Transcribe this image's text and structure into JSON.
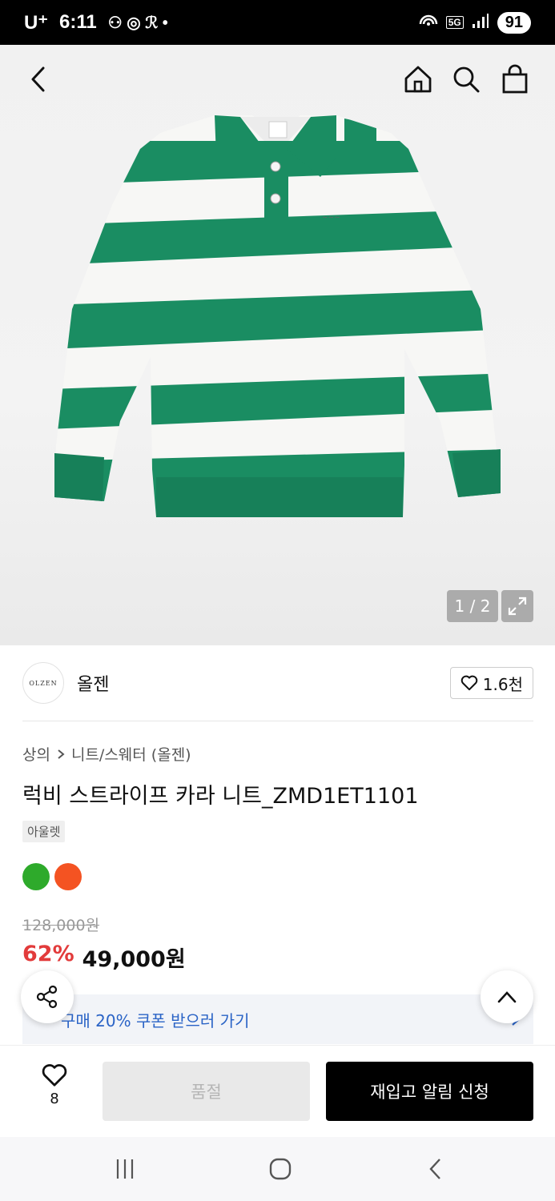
{
  "status_bar": {
    "carrier": "U⁺",
    "time": "6:11",
    "network": "5G",
    "battery": "91"
  },
  "colors": {
    "accent_red": "#e23b3b",
    "link_blue": "#2a63c6",
    "sweater_green": "#1a8d62",
    "swatch_green": "#2eaa2b",
    "swatch_orange": "#f45322"
  },
  "gallery": {
    "counter": "1 / 2"
  },
  "brand": {
    "logo_text": "OLZEN",
    "name": "올젠",
    "likes": "1.6천"
  },
  "breadcrumb": {
    "category": "상의",
    "subcategory": "니트/스웨터 (올젠)"
  },
  "product": {
    "title": "럭비 스트라이프 카라 니트_ZMD1ET1101",
    "tag": "아울렛",
    "swatches": [
      "green",
      "orange"
    ],
    "original_price": "128,000원",
    "discount": "62%",
    "price": "49,000원"
  },
  "coupon": {
    "label": "구매 20% 쿠폰 받으러 가기"
  },
  "bottom_bar": {
    "wish_count": "8",
    "soldout_label": "품절",
    "restock_label": "재입고 알림 신청"
  }
}
